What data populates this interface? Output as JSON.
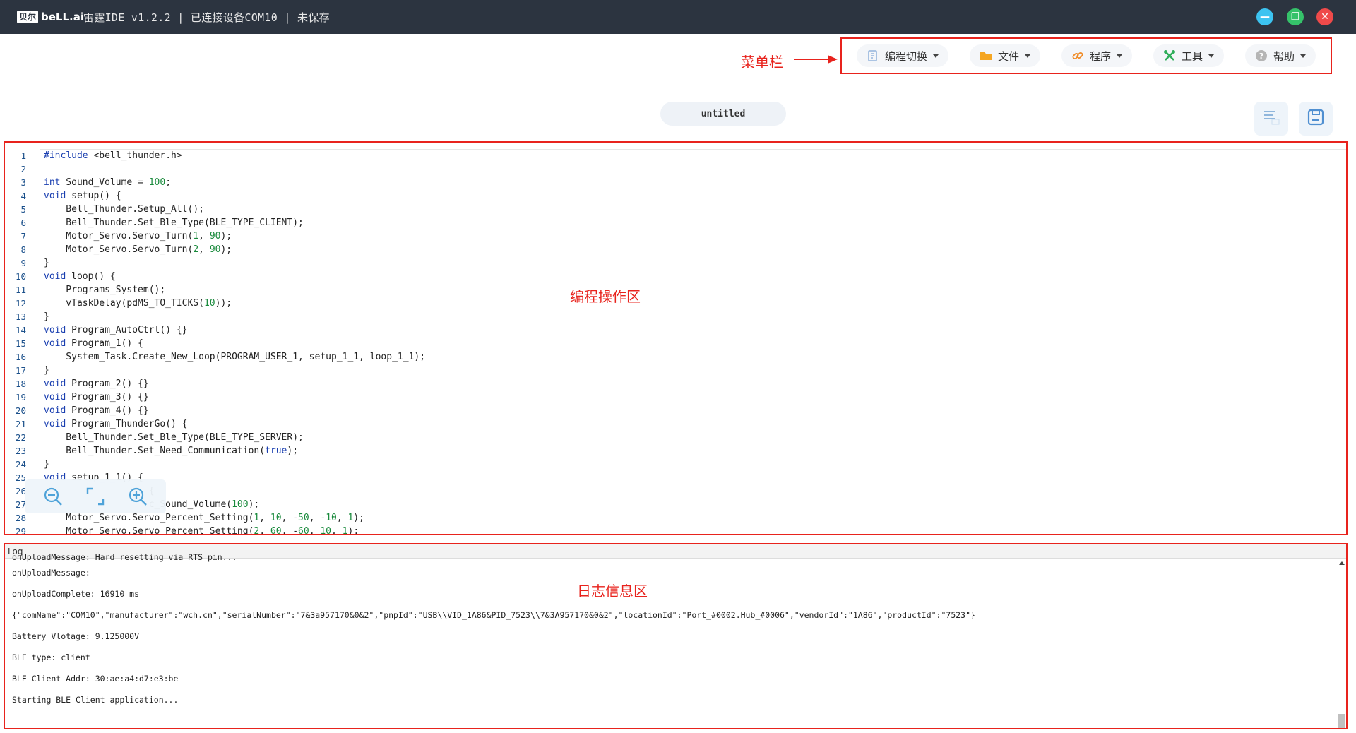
{
  "titlebar": {
    "logo_box": "贝尔",
    "logo_word": "beLL.ai",
    "title": "雷霆IDE v1.2.2 | 已连接设备COM10 | 未保存",
    "minimize_label": "—",
    "maximize_label": "❐",
    "close_label": "✕"
  },
  "annotations": {
    "menu": "菜单栏",
    "editor": "编程操作区",
    "log": "日志信息区"
  },
  "menu": {
    "items": [
      {
        "label": "编程切换",
        "icon": "code-switch-icon"
      },
      {
        "label": "文件",
        "icon": "folder-icon"
      },
      {
        "label": "程序",
        "icon": "link-icon"
      },
      {
        "label": "工具",
        "icon": "tools-icon"
      },
      {
        "label": "帮助",
        "icon": "help-icon"
      }
    ]
  },
  "file_tab": {
    "name": "untitled"
  },
  "editor": {
    "lines": [
      {
        "n": "1",
        "segments": [
          {
            "t": "#include",
            "c": "kw"
          },
          {
            "t": " <bell_thunder.h>",
            "c": ""
          }
        ]
      },
      {
        "n": "2",
        "segments": [
          {
            "t": "",
            "c": ""
          }
        ]
      },
      {
        "n": "3",
        "segments": [
          {
            "t": "int",
            "c": "kw"
          },
          {
            "t": " Sound_Volume = ",
            "c": ""
          },
          {
            "t": "100",
            "c": "num"
          },
          {
            "t": ";",
            "c": ""
          }
        ]
      },
      {
        "n": "4",
        "segments": [
          {
            "t": "void",
            "c": "kw"
          },
          {
            "t": " setup() {",
            "c": ""
          }
        ]
      },
      {
        "n": "5",
        "segments": [
          {
            "t": "    Bell_Thunder.Setup_All();",
            "c": ""
          }
        ]
      },
      {
        "n": "6",
        "segments": [
          {
            "t": "    Bell_Thunder.Set_Ble_Type(BLE_TYPE_CLIENT);",
            "c": ""
          }
        ]
      },
      {
        "n": "7",
        "segments": [
          {
            "t": "    Motor_Servo.Servo_Turn(",
            "c": ""
          },
          {
            "t": "1",
            "c": "num"
          },
          {
            "t": ", ",
            "c": ""
          },
          {
            "t": "90",
            "c": "num"
          },
          {
            "t": ");",
            "c": ""
          }
        ]
      },
      {
        "n": "8",
        "segments": [
          {
            "t": "    Motor_Servo.Servo_Turn(",
            "c": ""
          },
          {
            "t": "2",
            "c": "num"
          },
          {
            "t": ", ",
            "c": ""
          },
          {
            "t": "90",
            "c": "num"
          },
          {
            "t": ");",
            "c": ""
          }
        ]
      },
      {
        "n": "9",
        "segments": [
          {
            "t": "}",
            "c": ""
          }
        ]
      },
      {
        "n": "10",
        "segments": [
          {
            "t": "void",
            "c": "kw"
          },
          {
            "t": " loop() {",
            "c": ""
          }
        ]
      },
      {
        "n": "11",
        "segments": [
          {
            "t": "    Programs_System();",
            "c": ""
          }
        ]
      },
      {
        "n": "12",
        "segments": [
          {
            "t": "    vTaskDelay(pdMS_TO_TICKS(",
            "c": ""
          },
          {
            "t": "10",
            "c": "num"
          },
          {
            "t": "));",
            "c": ""
          }
        ]
      },
      {
        "n": "13",
        "segments": [
          {
            "t": "}",
            "c": ""
          }
        ]
      },
      {
        "n": "14",
        "segments": [
          {
            "t": "void",
            "c": "kw"
          },
          {
            "t": " Program_AutoCtrl() {}",
            "c": ""
          }
        ]
      },
      {
        "n": "15",
        "segments": [
          {
            "t": "void",
            "c": "kw"
          },
          {
            "t": " Program_1() {",
            "c": ""
          }
        ]
      },
      {
        "n": "16",
        "segments": [
          {
            "t": "    System_Task.Create_New_Loop(PROGRAM_USER_1, setup_1_1, loop_1_1);",
            "c": ""
          }
        ]
      },
      {
        "n": "17",
        "segments": [
          {
            "t": "}",
            "c": ""
          }
        ]
      },
      {
        "n": "18",
        "segments": [
          {
            "t": "void",
            "c": "kw"
          },
          {
            "t": " Program_2() {}",
            "c": ""
          }
        ]
      },
      {
        "n": "19",
        "segments": [
          {
            "t": "void",
            "c": "kw"
          },
          {
            "t": " Program_3() {}",
            "c": ""
          }
        ]
      },
      {
        "n": "20",
        "segments": [
          {
            "t": "void",
            "c": "kw"
          },
          {
            "t": " Program_4() {}",
            "c": ""
          }
        ]
      },
      {
        "n": "21",
        "segments": [
          {
            "t": "void",
            "c": "kw"
          },
          {
            "t": " Program_ThunderGo() {",
            "c": ""
          }
        ]
      },
      {
        "n": "22",
        "segments": [
          {
            "t": "    Bell_Thunder.Set_Ble_Type(BLE_TYPE_SERVER);",
            "c": ""
          }
        ]
      },
      {
        "n": "23",
        "segments": [
          {
            "t": "    Bell_Thunder.Set_Need_Communication(",
            "c": ""
          },
          {
            "t": "true",
            "c": "kw"
          },
          {
            "t": ");",
            "c": ""
          }
        ]
      },
      {
        "n": "24",
        "segments": [
          {
            "t": "}",
            "c": ""
          }
        ]
      },
      {
        "n": "25",
        "segments": [
          {
            "t": "void",
            "c": "kw"
          },
          {
            "t": " setup_1_1() {",
            "c": ""
          }
        ]
      },
      {
        "n": "26",
        "segments": [
          {
            "t": "                   {",
            "c": ""
          }
        ]
      },
      {
        "n": "27",
        "segments": [
          {
            "t": "                   c_Sound_Volume(",
            "c": ""
          },
          {
            "t": "100",
            "c": "num"
          },
          {
            "t": ");",
            "c": ""
          }
        ]
      },
      {
        "n": "28",
        "segments": [
          {
            "t": "    Motor_Servo.Servo_Percent_Setting(",
            "c": ""
          },
          {
            "t": "1",
            "c": "num"
          },
          {
            "t": ", ",
            "c": ""
          },
          {
            "t": "10",
            "c": "num"
          },
          {
            "t": ", -",
            "c": ""
          },
          {
            "t": "50",
            "c": "num"
          },
          {
            "t": ", -",
            "c": ""
          },
          {
            "t": "10",
            "c": "num"
          },
          {
            "t": ", ",
            "c": ""
          },
          {
            "t": "1",
            "c": "num"
          },
          {
            "t": ");",
            "c": ""
          }
        ]
      },
      {
        "n": "29",
        "segments": [
          {
            "t": "    Motor_Servo.Servo_Percent_Setting(",
            "c": ""
          },
          {
            "t": "2",
            "c": "num"
          },
          {
            "t": ", ",
            "c": ""
          },
          {
            "t": "60",
            "c": "num"
          },
          {
            "t": ", -",
            "c": ""
          },
          {
            "t": "60",
            "c": "num"
          },
          {
            "t": ", ",
            "c": ""
          },
          {
            "t": "10",
            "c": "num"
          },
          {
            "t": ", ",
            "c": ""
          },
          {
            "t": "1",
            "c": "num"
          },
          {
            "t": ");",
            "c": ""
          }
        ]
      }
    ]
  },
  "log": {
    "header": "Log",
    "lines": [
      "onUploadMessage: Hard resetting via RTS pin...",
      "onUploadMessage:",
      "onUploadComplete: 16910 ms",
      "{\"comName\":\"COM10\",\"manufacturer\":\"wch.cn\",\"serialNumber\":\"7&3a957170&0&2\",\"pnpId\":\"USB\\\\VID_1A86&PID_7523\\\\7&3A957170&0&2\",\"locationId\":\"Port_#0002.Hub_#0006\",\"vendorId\":\"1A86\",\"productId\":\"7523\"}",
      "Battery Vlotage: 9.125000V",
      "BLE type: client",
      "BLE Client Addr: 30:ae:a4:d7:e3:be",
      "Starting BLE Client application..."
    ]
  },
  "colors": {
    "titlebar_bg": "#2c3440",
    "annotation_red": "#e8231d",
    "run_button": "#f59a17"
  }
}
